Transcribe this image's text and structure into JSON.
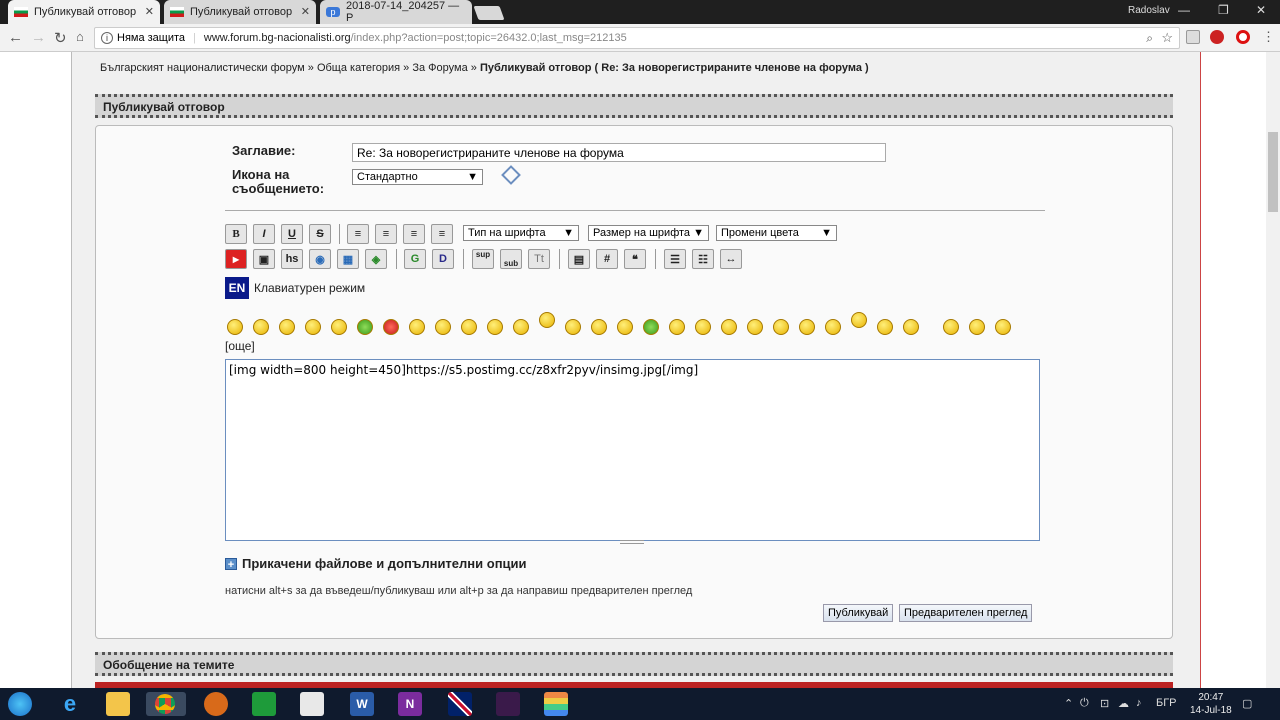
{
  "browser": {
    "tabs": [
      {
        "title": "Публикувай отговор",
        "active": true
      },
      {
        "title": "Публикувай отговор",
        "active": false
      },
      {
        "title": "2018-07-14_204257 — P",
        "active": false
      }
    ],
    "user": "Radoslav",
    "security_label": "Няма защита",
    "url_host": "www.forum.bg-nacionalisti.org",
    "url_path": "/index.php?action=post;topic=26432.0;last_msg=212135"
  },
  "breadcrumb": {
    "part1": "Българският националистически форум",
    "part2": "Обща категория",
    "part3": "За Форума",
    "current": "Публикувай отговор",
    "topic": "( Re: За новорегистрираните членове на форума )",
    "sep": "»"
  },
  "post": {
    "section_title": "Публикувай отговор",
    "subject_label": "Заглавие:",
    "subject_value": "Re: За новорегистрираните членове на форума",
    "icon_label_1": "Икона на",
    "icon_label_2": "съобщението:",
    "icon_value": "Стандартно",
    "font_face": "Тип на шрифта",
    "font_size": "Размер на шрифта",
    "font_color": "Промени цвета",
    "kb_badge": "EN",
    "kb_label": "Клавиатурен режим",
    "more_smileys": "[още]",
    "message": "[img width=800 height=450]https://s5.postimg.cc/z8xfr2pyv/insimg.jpg[/img]",
    "attach_label": "Прикачени файлове и допълнителни опции",
    "hint": "натисни alt+s за да въведеш/публикуваш или alt+p за да направиш предварителен преглед",
    "post_button": "Публикувай",
    "preview_button": "Предварителен преглед"
  },
  "summary_title": "Обобщение на темите",
  "toolbar": {
    "row1": [
      "B",
      "I",
      "U",
      "S"
    ],
    "row2": [
      "hs",
      "sup",
      "sub",
      "Tt",
      "#"
    ]
  },
  "taskbar": {
    "lang": "БГР",
    "time": "20:47",
    "date": "14-Jul-18"
  },
  "colors": {
    "accent_dark": "#0a1a8a",
    "taskbar": "#0f1a2d",
    "catbar": "#d4d4d4"
  }
}
